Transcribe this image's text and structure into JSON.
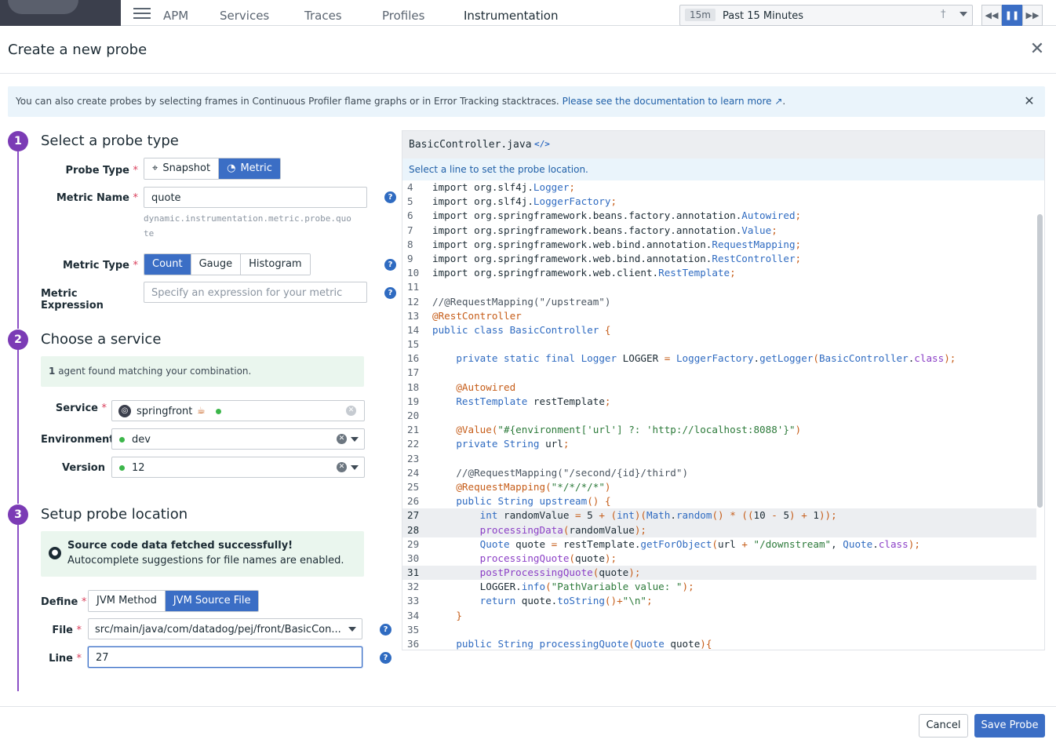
{
  "topnav": {
    "items": [
      "APM",
      "Services",
      "Traces",
      "Profiles",
      "Instrumentation"
    ],
    "active": "Instrumentation",
    "time_tag": "15m",
    "time_label": "Past 15 Minutes"
  },
  "modal": {
    "title": "Create a new probe",
    "banner_text": "You can also create probes by selecting frames in Continuous Profiler flame graphs or in Error Tracking stacktraces.",
    "banner_link": "Please see the documentation to learn more",
    "banner_tail": "."
  },
  "step1": {
    "num": "1",
    "title": "Select a probe type",
    "probe_type_label": "Probe Type",
    "probe_type_options": [
      "Snapshot",
      "Metric"
    ],
    "probe_type_selected": "Metric",
    "metric_name_label": "Metric Name",
    "metric_name_value": "quote",
    "metric_name_hint_1": "dynamic.instrumentation.metric.probe.quo",
    "metric_name_hint_2": "te",
    "metric_type_label": "Metric Type",
    "metric_type_options": [
      "Count",
      "Gauge",
      "Histogram"
    ],
    "metric_type_selected": "Count",
    "metric_expression_label": "Metric Expression",
    "metric_expression_placeholder": "Specify an expression for your metric"
  },
  "step2": {
    "num": "2",
    "title": "Choose a service",
    "agent_count": "1",
    "agent_text": "agent found matching your combination.",
    "service_label": "Service",
    "service_value": "springfront",
    "environment_label": "Environment",
    "environment_value": "dev",
    "version_label": "Version",
    "version_value": "12"
  },
  "step3": {
    "num": "3",
    "title": "Setup probe location",
    "success_title": "Source code data fetched successfully!",
    "success_text": "Autocomplete suggestions for file names are enabled.",
    "define_label": "Define",
    "define_options": [
      "JVM Method",
      "JVM Source File"
    ],
    "define_selected": "JVM Source File",
    "file_label": "File",
    "file_value": "src/main/java/com/datadog/pej/front/BasicCon...",
    "line_label": "Line",
    "line_value": "27"
  },
  "code": {
    "filename": "BasicController.java",
    "note": "Select a line to set the probe location.",
    "highlighted_lines": [
      27,
      28,
      31
    ]
  },
  "footer": {
    "cancel": "Cancel",
    "save": "Save Probe"
  },
  "colors": {
    "accent": "#3b6ec5",
    "step": "#7b3bb5",
    "required": "#d93f5b",
    "success_bg": "#eaf6ee"
  }
}
